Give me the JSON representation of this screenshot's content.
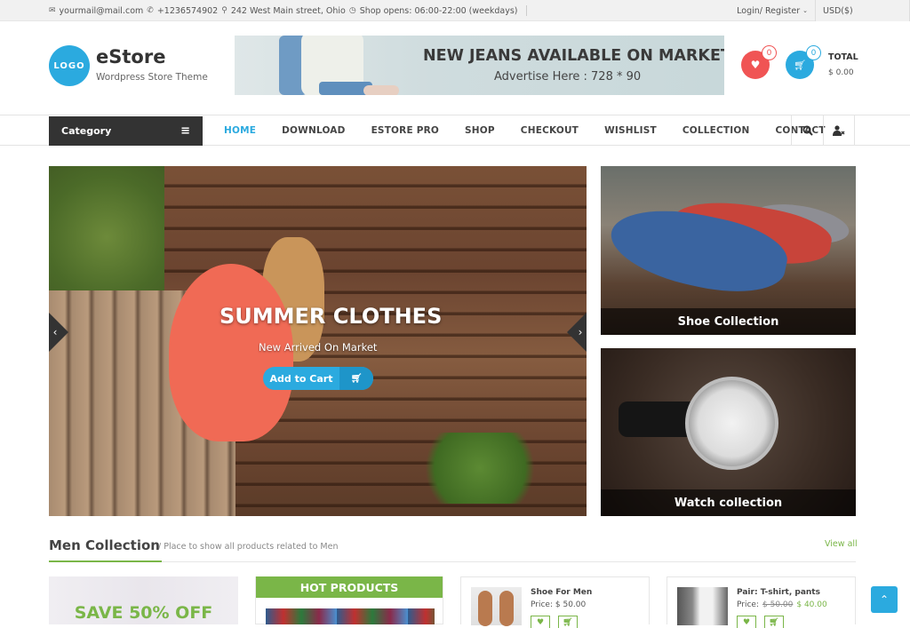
{
  "topbar": {
    "email": "yourmail@mail.com",
    "phone": "+1236574902",
    "address": "242 West Main street, Ohio",
    "hours": "Shop opens: 06:00-22:00 (weekdays)",
    "login_label": "Login/ Register",
    "currency": "USD($)",
    "icons": {
      "email": "envelope-icon",
      "phone": "phone-icon",
      "address": "map-marker-icon",
      "hours": "clock-icon"
    }
  },
  "header": {
    "logo_text": "LOGO",
    "site_name": "eStore",
    "tagline": "Wordpress Store Theme",
    "banner": {
      "title": "NEW JEANS AVAILABLE ON MARKET",
      "subtitle": "Advertise Here : 728 * 90"
    },
    "wishlist_count": "0",
    "cart_count": "0",
    "total_label": "TOTAL",
    "total_value": "$ 0.00",
    "colors": {
      "brand": "#2baadf",
      "wishlist": "#f05454",
      "accent_green": "#7ab648"
    }
  },
  "nav": {
    "category_label": "Category",
    "items": [
      {
        "label": "HOME",
        "active": true
      },
      {
        "label": "DOWNLOAD"
      },
      {
        "label": "ESTORE PRO"
      },
      {
        "label": "SHOP"
      },
      {
        "label": "CHECKOUT"
      },
      {
        "label": "WISHLIST"
      },
      {
        "label": "COLLECTION"
      },
      {
        "label": "CONTACT"
      }
    ]
  },
  "slider": {
    "title": "SUMMER CLOTHES",
    "subtitle": "New Arrived On Market",
    "button_label": "Add to Cart",
    "prev": "‹",
    "next": "›"
  },
  "promos": [
    {
      "caption": "Shoe Collection"
    },
    {
      "caption": "Watch collection"
    }
  ],
  "section": {
    "title": "Men Collection",
    "subtitle": "/ Place to show all products related to Men",
    "view_all": "View all"
  },
  "save_banner": "SAVE 50% OFF",
  "hot_products": "HOT PRODUCTS",
  "products": [
    {
      "name": "Shoe For Men",
      "price_label": "Price:",
      "price": "$ 50.00",
      "old_price": ""
    },
    {
      "name": "Pair: T-shirt, pants",
      "price_label": "Price:",
      "price": "$ 40.00",
      "old_price": "$ 50.00"
    }
  ]
}
